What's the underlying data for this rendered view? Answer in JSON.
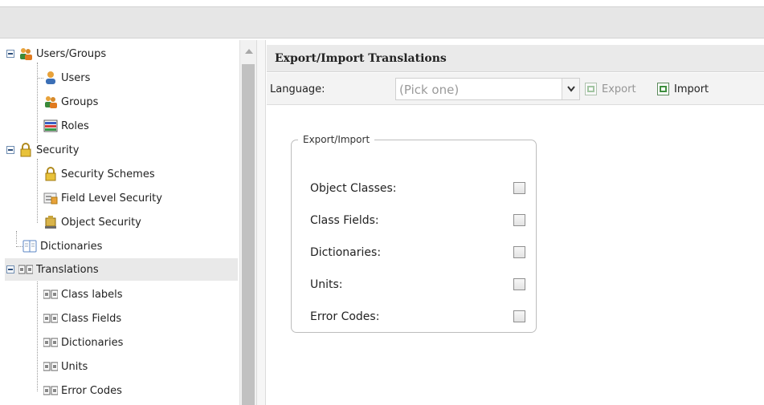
{
  "tree": {
    "users_groups": "Users/Groups",
    "users": "Users",
    "groups": "Groups",
    "roles": "Roles",
    "security": "Security",
    "security_schemes": "Security Schemes",
    "field_level_security": "Field Level Security",
    "object_security": "Object Security",
    "dictionaries": "Dictionaries",
    "translations": "Translations",
    "class_labels": "Class labels",
    "class_fields": "Class Fields",
    "t_dictionaries": "Dictionaries",
    "units": "Units",
    "error_codes": "Error Codes"
  },
  "panel": {
    "title": "Export/Import Translations"
  },
  "toolbar": {
    "language_label": "Language:",
    "language_placeholder": "(Pick one)",
    "export_label": "Export",
    "import_label": "Import"
  },
  "form": {
    "legend": "Export/Import",
    "options": [
      {
        "label": "Object Classes:",
        "checked": false
      },
      {
        "label": "Class Fields:",
        "checked": false
      },
      {
        "label": "Dictionaries:",
        "checked": false
      },
      {
        "label": "Units:",
        "checked": false
      },
      {
        "label": "Error Codes:",
        "checked": false
      }
    ]
  },
  "colors": {
    "selected_row": "#e9e9e9",
    "header_bg": "#eaeaea",
    "topbar_bg": "#e6e6e6"
  }
}
